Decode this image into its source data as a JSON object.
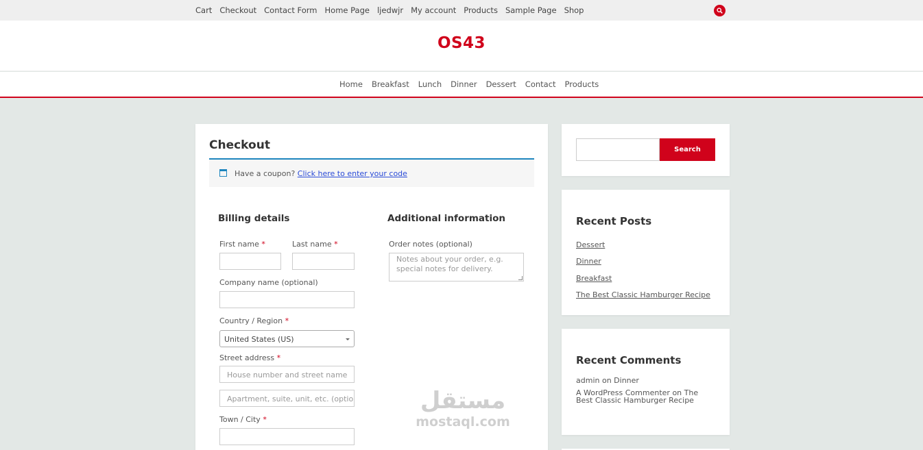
{
  "topbar": {
    "links": [
      "Cart",
      "Checkout",
      "Contact Form",
      "Home Page",
      "ljedwjr",
      "My account",
      "Products",
      "Sample Page",
      "Shop"
    ],
    "search_icon": "search-icon",
    "accent": "#d0021b"
  },
  "header": {
    "logo": "OS43"
  },
  "mainnav": {
    "links": [
      "Home",
      "Breakfast",
      "Lunch",
      "Dinner",
      "Dessert",
      "Contact",
      "Products"
    ]
  },
  "checkout": {
    "title": "Checkout",
    "coupon_text": "Have a coupon?",
    "coupon_link": "Click here to enter your code",
    "billing": {
      "title": "Billing details",
      "first_name_label": "First name",
      "last_name_label": "Last name",
      "company_label": "Company name (optional)",
      "country_label": "Country / Region",
      "country_value": "United States (US)",
      "street_label": "Street address",
      "street_placeholder": "House number and street name",
      "apartment_placeholder": "Apartment, suite, unit, etc. (optional)",
      "city_label": "Town / City",
      "required_mark": "*"
    },
    "additional": {
      "title": "Additional information",
      "notes_label": "Order notes (optional)",
      "notes_placeholder": "Notes about your order, e.g. special notes for delivery."
    }
  },
  "sidebar": {
    "search_button": "Search",
    "recent_posts": {
      "title": "Recent Posts",
      "items": [
        "Dessert",
        "Dinner",
        "Breakfast",
        "The Best Classic Hamburger Recipe"
      ]
    },
    "recent_comments": {
      "title": "Recent Comments",
      "items": [
        {
          "author": "admin",
          "on": "on",
          "post": "Dinner"
        },
        {
          "author": "A WordPress Commenter",
          "on": "on",
          "post": "The Best Classic Hamburger Recipe"
        }
      ]
    }
  },
  "watermark": {
    "arabic": "مستقل",
    "latin": "mostaql.com"
  }
}
